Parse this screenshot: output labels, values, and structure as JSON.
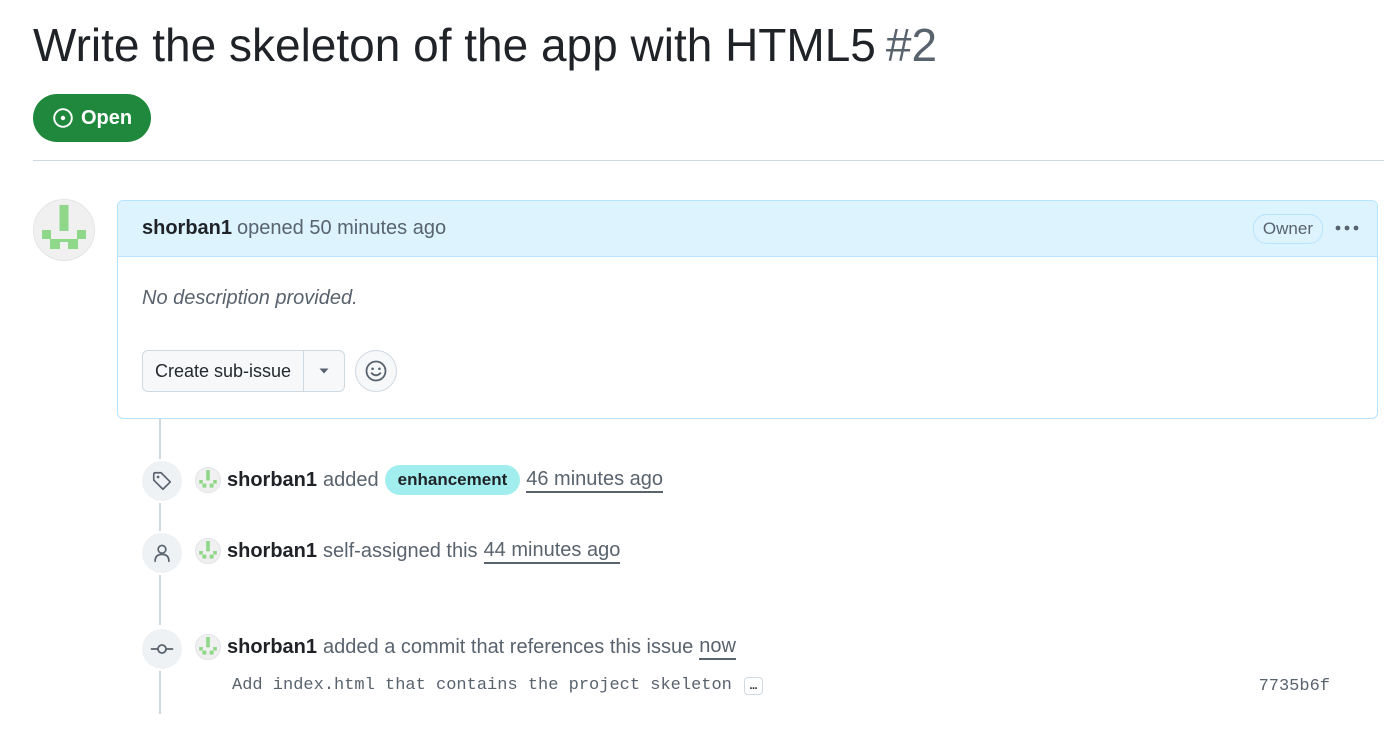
{
  "issue": {
    "title": "Write the skeleton of the app with HTML5",
    "number": "#2",
    "state": "Open"
  },
  "comment": {
    "author": "shorban1",
    "meta": "opened 50 minutes ago",
    "owner_badge": "Owner",
    "description": "No description provided.",
    "create_sub_issue_label": "Create sub-issue"
  },
  "timeline": [
    {
      "icon": "tag-icon",
      "actor": "shorban1",
      "text": "added",
      "label": "enhancement",
      "time": "46 minutes ago"
    },
    {
      "icon": "person-icon",
      "actor": "shorban1",
      "text": "self-assigned this",
      "time": "44 minutes ago"
    },
    {
      "icon": "git-commit-icon",
      "actor": "shorban1",
      "text": "added a commit that references this issue",
      "time": "now",
      "commit_message": "Add index.html that contains the project skeleton",
      "commit_expand": "…",
      "commit_sha": "7735b6f"
    }
  ],
  "colors": {
    "open_green": "#1f883d",
    "header_blue": "#ddf4ff",
    "label_enhancement": "#a2eeef",
    "avatar_green": "#8fd88a"
  }
}
